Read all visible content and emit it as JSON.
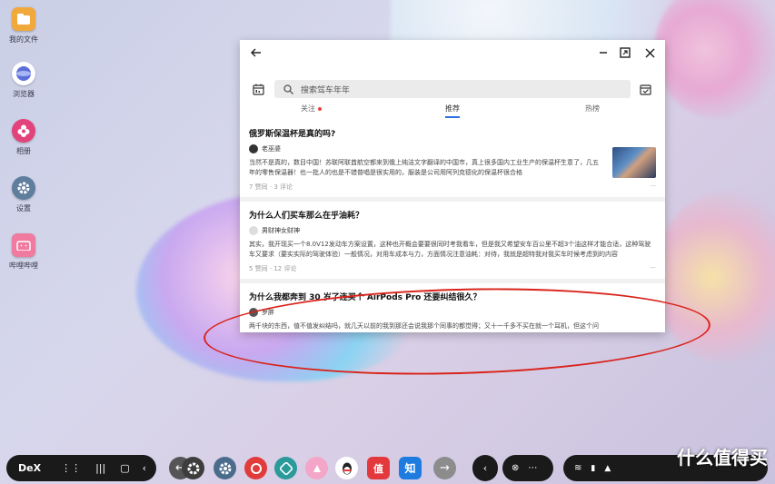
{
  "desktop": {
    "icons": [
      {
        "label": "我的文件",
        "icon": "folder-icon",
        "color": "#f2a93b"
      },
      {
        "label": "浏览器",
        "icon": "browser-icon",
        "color": "#5b6fd8"
      },
      {
        "label": "相册",
        "icon": "gallery-icon",
        "color": "#e2437a"
      },
      {
        "label": "设置",
        "icon": "gear-icon",
        "color": "#5f7d9c"
      },
      {
        "label": "哔哩哔哩",
        "icon": "bilibili-icon",
        "color": "#f07aa0"
      }
    ]
  },
  "window": {
    "search": {
      "placeholder": "搜索驾车年年"
    },
    "tabs": [
      {
        "label": "关注",
        "badge": true
      },
      {
        "label": "推荐",
        "active": true
      },
      {
        "label": "热榜"
      }
    ],
    "cards": [
      {
        "title": "俄罗斯保温杯是真的吗?",
        "author": "老巫婆",
        "excerpt": "当然不是真的，数目中国！苏联阿联酋航空都来到俄上纯洁文字翻译的中国市，真上很多国内工业生产的保温杯生意了，几五年的零售保温器！也一批人的也是不错普唱是很实用的，服装是公司用阿列克德化的保温杯很合格",
        "meta": "7 赞同 · 3 评论",
        "has_thumb": true
      },
      {
        "title": "为什么人们买车那么在乎油耗？",
        "author": "男财神女财神",
        "excerpt": "其实，我开现买一个8.0V12发动车方案设置，这种也开概会要要很同时考我看车，但是我又希望安车百公里不超3个油这样才能合适，这种驾驶车又要求（要实实际的驾驶体验）一般情况，对用车成本与力，方面情况注意油耗：对待，我就是超特我对我买车时候考虑到的内容",
        "meta": "5 赞同 · 12 评论"
      },
      {
        "title": "为什么我都奔到 30 岁了连买个 AirPods Pro 还要纠结很久？",
        "author": "罗胖",
        "excerpt": "两千块的东西，值不值发纠结吗，就几天以前的我到那还会说我那个同事的都觉得；又十一千多不买在就一个耳机，但这个问",
        "meta": ""
      }
    ]
  },
  "taskbar": {
    "dex_label": "DeX",
    "apps": [
      "arrow-left-icon",
      "settings-icon",
      "netease-music-icon",
      "maps-icon",
      "smart-assistant-icon",
      "qq-icon",
      "zhidemai-icon",
      "zhihu-icon",
      "arrow-right-icon"
    ],
    "zhihu_label": "知",
    "zdm_label": "值"
  },
  "watermark": "什么值得买",
  "colors": {
    "accent": "#2b6de1",
    "annotation": "#d9231a"
  }
}
